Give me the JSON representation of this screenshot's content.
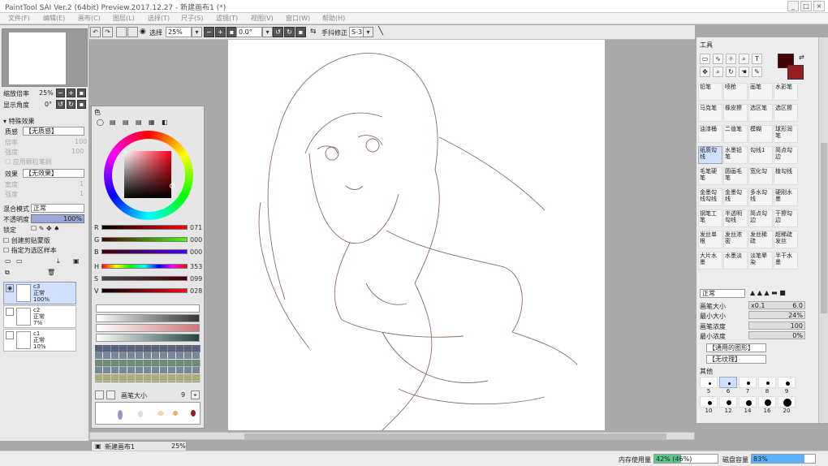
{
  "window": {
    "title": "PaintTool SAI Ver.2 (64bit) Preview.2017.12.27 - 新建画布1 (*)",
    "minimize": "_",
    "maximize": "□",
    "close": "×"
  },
  "menu": [
    "文件(F)",
    "编辑(E)",
    "画布(C)",
    "图层(L)",
    "选择(T)",
    "尺子(S)",
    "滤镜(T)",
    "视图(V)",
    "窗口(W)",
    "帮助(H)"
  ],
  "toolbar": {
    "select_label": "选择",
    "zoom": "25%",
    "rotation": "0.0°",
    "stabilizer_label": "手抖修正",
    "stabilizer": "S-3"
  },
  "navigator": {
    "zoom_label": "缩放倍率",
    "zoom_value": "25%",
    "angle_label": "显示角度",
    "angle_value": "0°"
  },
  "effects": {
    "header": "特殊效果",
    "texture_label": "质感",
    "texture_value": "【无质感】",
    "scale_label": "倍率",
    "strength_label": "强度",
    "strength_value": "100",
    "scale_value": "1",
    "apply_texture": "应用颗粒笔刷",
    "effect_label": "效果",
    "effect_value": "【无效果】",
    "width_label": "宽度",
    "width_value": "1",
    "intensity_label": "强度",
    "intensity_value": "1"
  },
  "layer_props": {
    "blend_label": "混合模式",
    "blend_value": "正常",
    "opacity_label": "不透明度",
    "opacity_value": "100%",
    "lock_label": "锁定",
    "clip_label": "创建剪贴蒙版",
    "sample_label": "指定为选区样本"
  },
  "layers": [
    {
      "name": "c3",
      "mode": "正常",
      "opacity": "100%"
    },
    {
      "name": "c2",
      "mode": "正常",
      "opacity": "7%"
    },
    {
      "name": "c1",
      "mode": "正常",
      "opacity": "10%"
    }
  ],
  "color_panel": {
    "title": "色",
    "R": {
      "label": "R",
      "value": "071"
    },
    "G": {
      "label": "G",
      "value": "000"
    },
    "B": {
      "label": "B",
      "value": "000"
    },
    "H": {
      "label": "H",
      "value": "353"
    },
    "S": {
      "label": "S",
      "value": "099"
    },
    "V": {
      "label": "V",
      "value": "028"
    },
    "brush_size_label": "画笔大小",
    "brush_size_value": "9"
  },
  "colors": {
    "current": "#470000",
    "secondary": "#9b1c1c",
    "accent": "#cfe0ff",
    "memory_green": "#5cc98a",
    "disk_blue": "#5bb0ff"
  },
  "tools_panel": {
    "title": "工具",
    "brushes": [
      [
        "铅笔",
        "喷枪",
        "画笔",
        "水彩笔"
      ],
      [
        "马克笔",
        "橡皮擦",
        "选区笔",
        "选区擦"
      ],
      [
        "油漆桶",
        "二值笔",
        "模糊",
        "球形润笔"
      ],
      [
        "纸质勾线",
        "水墨铅笔",
        "勾线1",
        "简点勾边"
      ],
      [
        "毛笔硬笔",
        "圆画毛笔",
        "宽化勾",
        "植勾线"
      ],
      [
        "金墨勾线勾线",
        "金墨勾线",
        "多水勾线",
        "硬刚水墨"
      ],
      [
        "钢笔工笔",
        "半透明勾线",
        "简点勾边",
        "干擦勾边"
      ],
      [
        "发丝单根",
        "发丝浓密",
        "发丝稀疏",
        "超稀疏发丝"
      ],
      [
        "大片水墨",
        "水墨淡",
        "淡笔晕染",
        "半干水墨"
      ]
    ],
    "mode_value": "正常",
    "size_label": "画笔大小",
    "size_mult": "x0.1",
    "size_value": "6.0",
    "min_size_label": "最小大小",
    "min_size_value": "24%",
    "density_label": "画笔浓度",
    "density_value": "100",
    "min_density_label": "最小浓度",
    "min_density_value": "0%",
    "shape_value": "【通用的图形】",
    "texture_value": "【无纹理】",
    "other_label": "其他",
    "sizes": [
      [
        "5",
        "6",
        "7",
        "8",
        "9"
      ],
      [
        "10",
        "12",
        "14",
        "16",
        "20"
      ]
    ]
  },
  "status": {
    "canvas_tab": "新建画布1",
    "canvas_zoom": "25%",
    "memory_label": "内存使用量",
    "memory_value": "42% (46%)",
    "memory_fill": 0.42,
    "disk_label": "磁盘容量",
    "disk_value": "83%",
    "disk_fill": 0.83
  }
}
